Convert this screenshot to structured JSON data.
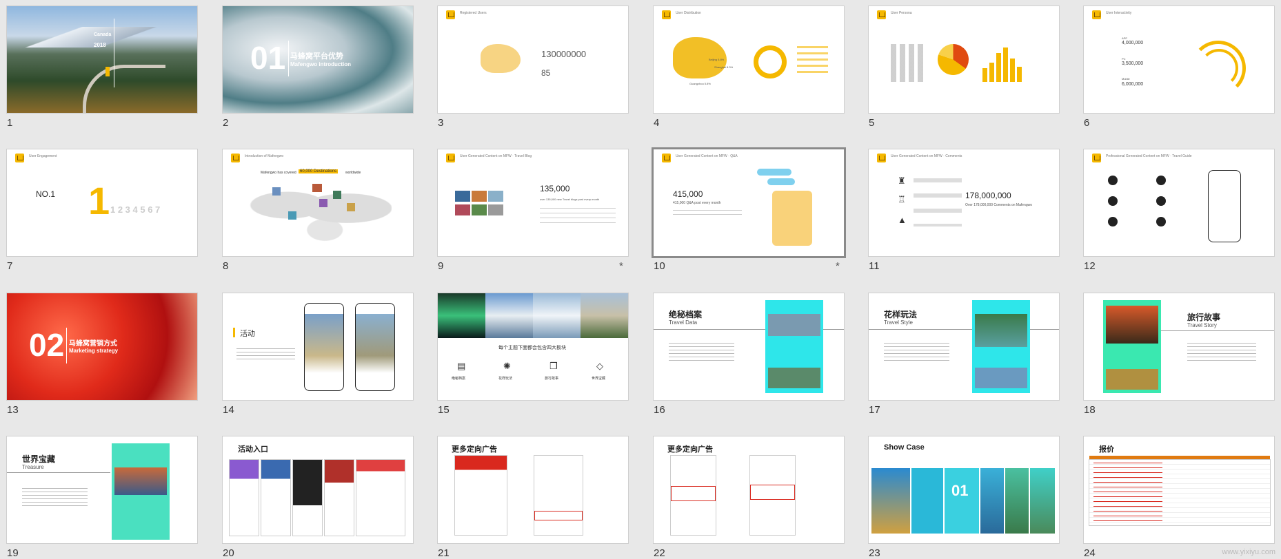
{
  "slides": [
    {
      "num": "1",
      "lines": [
        "Canada",
        "2018"
      ]
    },
    {
      "num": "2",
      "big": "01",
      "title": "马蜂窝平台优势",
      "subtitle": "Mafengwo introduction"
    },
    {
      "num": "3",
      "header": "Registered Users",
      "value": "130000000",
      "pct": "85"
    },
    {
      "num": "4",
      "header": "User Distribution",
      "labels": [
        "Beijing 5.8%",
        "Shanghai 8.3%",
        "Guangzhou 5.8%"
      ]
    },
    {
      "num": "5",
      "header": "User Persona"
    },
    {
      "num": "6",
      "header": "User Interactivity",
      "values": [
        "4,000,000",
        "3,500,000",
        "6,000,000"
      ],
      "devices": [
        "APP",
        "PC",
        "Mobile"
      ]
    },
    {
      "num": "7",
      "header": "User Engagement",
      "rank": "NO.1",
      "digits": "1 2 3 4 5 6 7"
    },
    {
      "num": "8",
      "header": "Introduction of Mafengwo",
      "tag": "60,000 Destinations",
      "pre": "Mafengwo has covered",
      "post": "worldwide"
    },
    {
      "num": "9",
      "header": "User Generated Content on MFW · Travel Blog",
      "value": "135,000",
      "sub": "over 135,000 new Travel blogs post every month",
      "starred": true
    },
    {
      "num": "10",
      "header": "User Generated Content on MFW · Q&A",
      "value": "415,000",
      "sub": "415,000 Q&A post every month",
      "starred": true,
      "selected": true
    },
    {
      "num": "11",
      "header": "User Generated Content on MFW · Comments",
      "value": "178,000,000",
      "sub": "Over 178,000,000 Comments on Mafengwo"
    },
    {
      "num": "12",
      "header": "Professional Generated Content on MFW · Travel Guide"
    },
    {
      "num": "13",
      "big": "02",
      "title": "马蜂窝营销方式",
      "subtitle": "Marketing strategy"
    },
    {
      "num": "14",
      "title": "活动"
    },
    {
      "num": "15",
      "caption": "每个主题下面都会包含四大板块",
      "icons": [
        "绝秘档案",
        "花样玩法",
        "旅行故事",
        "世界宝藏"
      ]
    },
    {
      "num": "16",
      "title": "绝秘档案",
      "subtitle": "Travel Data"
    },
    {
      "num": "17",
      "title": "花样玩法",
      "subtitle": "Travel Style"
    },
    {
      "num": "18",
      "title": "旅行故事",
      "subtitle": "Travel Story"
    },
    {
      "num": "19",
      "title": "世界宝藏",
      "subtitle": "Treasure"
    },
    {
      "num": "20",
      "title": "活动入口"
    },
    {
      "num": "21",
      "title": "更多定向广告"
    },
    {
      "num": "22",
      "title": "更多定向广告"
    },
    {
      "num": "23",
      "title": "Show Case",
      "big": "01"
    },
    {
      "num": "24",
      "title": "报价"
    }
  ],
  "watermark": "www.yixiyu.com",
  "colors": {
    "accent": "#f5b800",
    "cyan": "#2ee6ea",
    "red": "#d9281e"
  }
}
